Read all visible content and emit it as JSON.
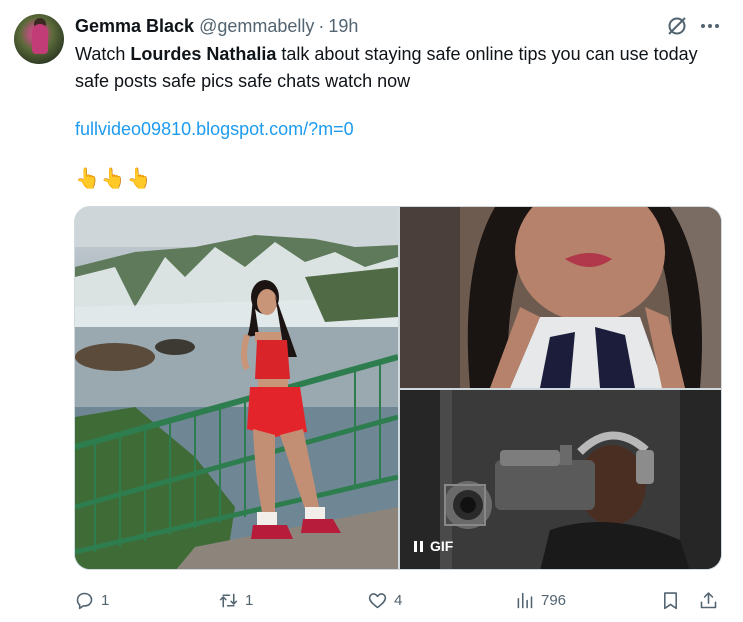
{
  "tweet": {
    "author_name": "Gemma Black",
    "author_handle": "@gemmabelly",
    "separator": "·",
    "time": "19h",
    "text_prefix": "Watch ",
    "text_bold": "Lourdes Nathalia",
    "text_suffix": " talk about staying safe online tips you can use today safe posts safe pics safe chats watch now",
    "link": "fullvideo09810.blogspot.com/?m=0",
    "emojis": "👆👆👆"
  },
  "media": {
    "items": [
      {
        "kind": "photo",
        "subject": "waterfall-portrait"
      },
      {
        "kind": "photo",
        "subject": "selfie-closeup"
      },
      {
        "kind": "gif",
        "subject": "camera-operator",
        "badge": "GIF"
      }
    ]
  },
  "actions": {
    "reply_count": "1",
    "repost_count": "1",
    "like_count": "4",
    "views_count": "796"
  },
  "icons": {
    "grok": "grok-icon",
    "more": "more-icon",
    "reply": "reply-icon",
    "repost": "repost-icon",
    "like": "like-icon",
    "views": "views-icon",
    "bookmark": "bookmark-icon",
    "share": "share-icon"
  },
  "colors": {
    "link": "#1d9bf0",
    "secondary_text": "#536471",
    "primary_text": "#0f1419",
    "border": "#cfd9de"
  }
}
